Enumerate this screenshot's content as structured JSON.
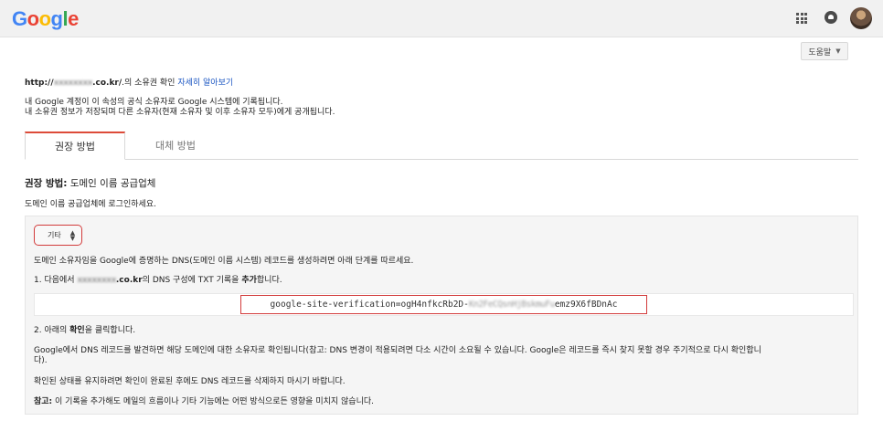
{
  "header": {
    "logo_letters": [
      {
        "ch": "G",
        "color": "#4285F4"
      },
      {
        "ch": "o",
        "color": "#EA4335"
      },
      {
        "ch": "o",
        "color": "#FBBC05"
      },
      {
        "ch": "g",
        "color": "#4285F4"
      },
      {
        "ch": "l",
        "color": "#34A853"
      },
      {
        "ch": "e",
        "color": "#EA4335"
      }
    ],
    "help_label": "도움말"
  },
  "ownership": {
    "url_prefix": "http://",
    "url_blur": "xxxxxxxx",
    "url_suffix": ".co.kr/",
    "text": ".의 소유권 확인",
    "learn_more": "자세히 알아보기",
    "line1": "내 Google 계정이 이 속성의 공식 소유자로 Google 시스템에 기록됩니다.",
    "line2": "내 소유권 정보가 저장되며 다른 소유자(현재 소유자 및 이후 소유자 모두)에게 공개됩니다."
  },
  "tabs": [
    {
      "label": "권장 방법",
      "active": true
    },
    {
      "label": "대체 방법",
      "active": false
    }
  ],
  "method": {
    "heading_bold": "권장 방법:",
    "heading_rest": " 도메인 이름 공급업체",
    "login_text": "도메인 이름 공급업체에 로그인하세요."
  },
  "panel": {
    "select_value": "기타",
    "intro": "도메인 소유자임을 Google에 증명하는 DNS(도메인 이름 시스템) 레코드를 생성하려면 아래 단계를 따르세요.",
    "step1_a": "1. 다음에서 ",
    "step1_blur": "xxxxxxxx",
    "step1_domain": ".co.kr",
    "step1_b": "의 DNS 구성에 TXT 기록을 ",
    "step1_bold": "추가",
    "step1_c": "합니다.",
    "txt_record_a": "google-site-verification=ogH4nfkcRb2D-",
    "txt_record_blur": "Kn2FeCQsnHjBskmuFu",
    "txt_record_b": "emz9X6fBDnAc",
    "step2_a": "2. 아래의 ",
    "step2_bold": "확인",
    "step2_b": "을 클릭합니다.",
    "para1_line1": "Google에서 DNS 레코드를 발견하면 해당 도메인에 대한 소유자로 확인됩니다(참고: DNS 변경이 적용되려면 다소 시간이 소요될 수 있습니다. Google은 레코드를 즉시 찾지 못할 경우 주기적으로 다시 확인합니",
    "para1_line2": "다).",
    "para2": "확인된 상태를 유지하려면 확인이 완료된 후에도 DNS 레코드를 삭제하지 마시기 바랍니다.",
    "note_bold": "참고:",
    "note_rest": " 이 기록을 추가해도 메일의 흐름이나 기타 기능에는 어떤 방식으로든 영향을 미치지 않습니다."
  }
}
